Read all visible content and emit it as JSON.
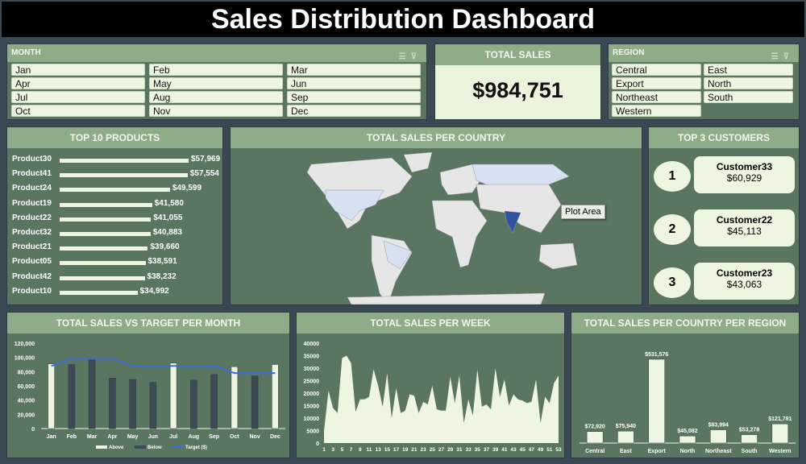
{
  "title": "Sales Distribution Dashboard",
  "month_slicer": {
    "header": "MONTH",
    "items": [
      "Jan",
      "Feb",
      "Mar",
      "Apr",
      "May",
      "Jun",
      "Jul",
      "Aug",
      "Sep",
      "Oct",
      "Nov",
      "Dec"
    ]
  },
  "total_sales": {
    "header": "TOTAL SALES",
    "value": "$984,751"
  },
  "region_slicer": {
    "header": "REGION",
    "items": [
      "Central",
      "East",
      "Export",
      "North",
      "Northeast",
      "South",
      "Western"
    ]
  },
  "top_products": {
    "header": "TOP 10 PRODUCTS",
    "items": [
      {
        "name": "Product30",
        "value": 57969,
        "label": "$57,969"
      },
      {
        "name": "Product41",
        "value": 57554,
        "label": "$57,554"
      },
      {
        "name": "Product24",
        "value": 49599,
        "label": "$49,599"
      },
      {
        "name": "Product19",
        "value": 41580,
        "label": "$41,580"
      },
      {
        "name": "Product22",
        "value": 41055,
        "label": "$41,055"
      },
      {
        "name": "Product32",
        "value": 40883,
        "label": "$40,883"
      },
      {
        "name": "Product21",
        "value": 39660,
        "label": "$39,660"
      },
      {
        "name": "Product05",
        "value": 38591,
        "label": "$38,591"
      },
      {
        "name": "Product42",
        "value": 38232,
        "label": "$38,232"
      },
      {
        "name": "Product10",
        "value": 34992,
        "label": "$34,992"
      }
    ]
  },
  "map": {
    "header": "TOTAL SALES PER COUNTRY",
    "tooltip": "Plot Area",
    "highlight_color": "#2f55a0",
    "light_color": "#d6e1f2",
    "base_color": "#e6e6e6"
  },
  "top_customers": {
    "header": "TOP 3 CUSTOMERS",
    "items": [
      {
        "rank": "1",
        "name": "Customer33",
        "value": "$60,929"
      },
      {
        "rank": "2",
        "name": "Customer22",
        "value": "$45,113"
      },
      {
        "rank": "3",
        "name": "Customer23",
        "value": "$43,063"
      }
    ]
  },
  "chart_data": [
    {
      "type": "bar",
      "title": "TOTAL SALES VS TARGET PER MONTH",
      "categories": [
        "Jan",
        "Feb",
        "Mar",
        "Apr",
        "May",
        "Jun",
        "Jul",
        "Aug",
        "Sep",
        "Oct",
        "Nov",
        "Dec"
      ],
      "series": [
        {
          "name": "Above",
          "values": [
            91000,
            null,
            null,
            null,
            null,
            null,
            92000,
            null,
            null,
            87000,
            null,
            90000
          ],
          "color": "#eef5e0"
        },
        {
          "name": "Below",
          "values": [
            null,
            90000,
            97000,
            71000,
            69000,
            65000,
            null,
            68000,
            76000,
            null,
            74000,
            null
          ],
          "color": "#3c4a56"
        },
        {
          "name": "Target ($)",
          "type": "line",
          "values": [
            88000,
            98000,
            98000,
            98000,
            88000,
            88000,
            88000,
            88000,
            88000,
            78000,
            78000,
            78000
          ],
          "color": "#3a6fd8"
        }
      ],
      "yticks": [
        "0",
        "20,000",
        "40,000",
        "60,000",
        "80,000",
        "100,000",
        "120,000"
      ],
      "ylim": [
        0,
        120000
      ],
      "legend": "bottom"
    },
    {
      "type": "area",
      "title": "TOTAL SALES PER WEEK",
      "x": [
        1,
        2,
        3,
        4,
        5,
        6,
        7,
        8,
        9,
        10,
        11,
        12,
        13,
        14,
        15,
        16,
        17,
        18,
        19,
        20,
        21,
        22,
        23,
        24,
        25,
        26,
        27,
        28,
        29,
        30,
        31,
        32,
        33,
        34,
        35,
        36,
        37,
        38,
        39,
        40,
        41,
        42,
        43,
        44,
        45,
        46,
        47,
        48,
        49,
        50,
        51,
        52,
        53
      ],
      "values": [
        5000,
        21000,
        14000,
        12000,
        34000,
        35000,
        32000,
        12500,
        17500,
        17500,
        18500,
        29500,
        23000,
        14500,
        28000,
        10000,
        22000,
        12000,
        13000,
        19500,
        19000,
        12000,
        16500,
        15500,
        23000,
        13500,
        13000,
        13000,
        26500,
        16000,
        27000,
        8000,
        17500,
        11000,
        29500,
        14500,
        15500,
        13500,
        30000,
        18500,
        25500,
        15000,
        19500,
        17500,
        17000,
        16000,
        16500,
        25500,
        8000,
        18500,
        16000,
        24000,
        27000
      ],
      "yticks": [
        "0",
        "5000",
        "10000",
        "15000",
        "20000",
        "25000",
        "30000",
        "35000",
        "40000"
      ],
      "ylim": [
        0,
        40000
      ],
      "xticks": [
        "1",
        "3",
        "5",
        "7",
        "9",
        "11",
        "13",
        "15",
        "17",
        "19",
        "21",
        "23",
        "25",
        "27",
        "29",
        "31",
        "33",
        "35",
        "37",
        "39",
        "41",
        "43",
        "45",
        "47",
        "49",
        "51",
        "53"
      ]
    },
    {
      "type": "bar",
      "title": "TOTAL SALES PER COUNTRY PER REGION",
      "categories": [
        "Central",
        "East",
        "Export",
        "North",
        "Northeast",
        "South",
        "Western"
      ],
      "values": [
        72920,
        75940,
        531576,
        45082,
        83994,
        53278,
        121781
      ],
      "labels": [
        "$72,920",
        "$75,940",
        "$531,576",
        "$45,082",
        "$83,994",
        "$53,278",
        "$121,781"
      ]
    }
  ],
  "colors": {
    "panel": "#5a7560",
    "header": "#8fab87",
    "light": "#eef5e0",
    "background": "#3a4854"
  }
}
